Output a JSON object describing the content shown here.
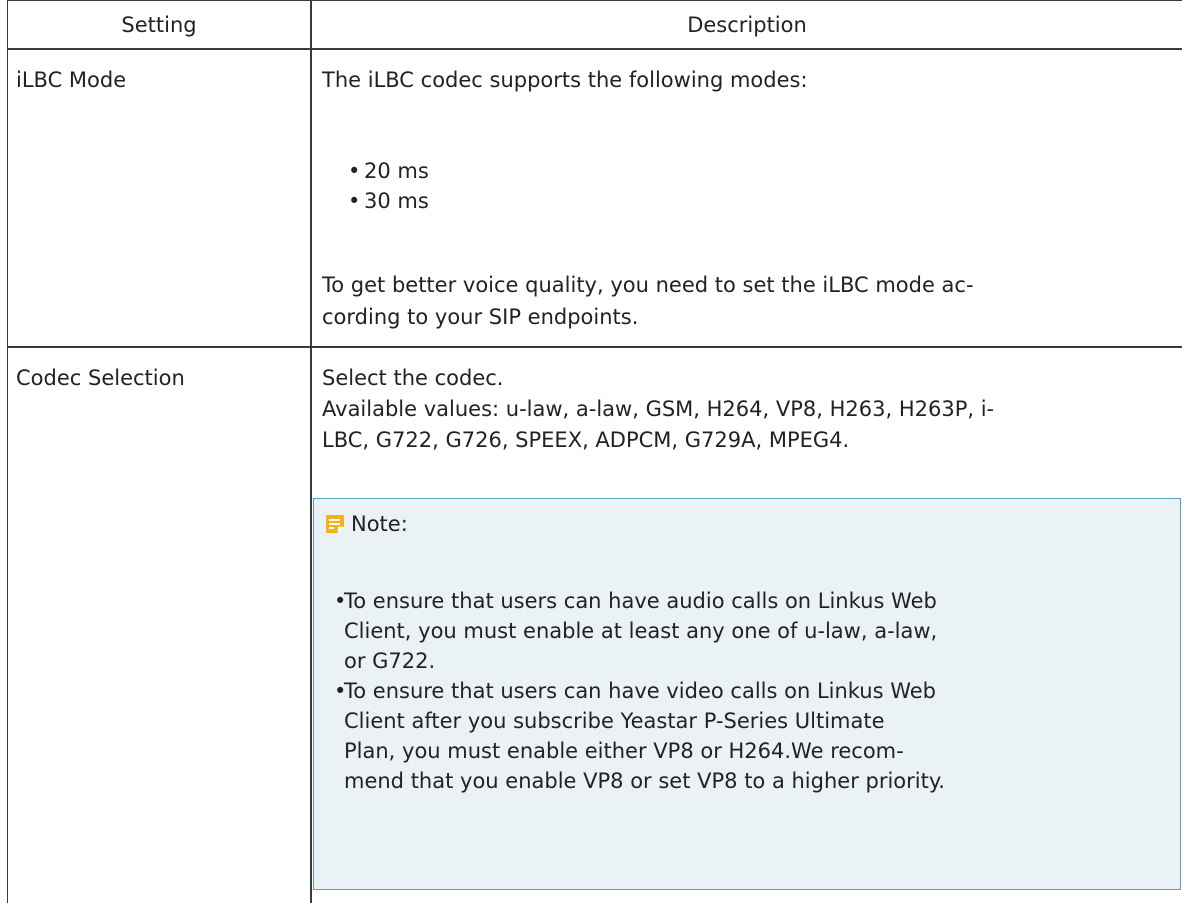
{
  "table": {
    "headers": {
      "setting": "Setting",
      "description": "Description"
    },
    "rows": [
      {
        "setting": "iLBC Mode",
        "intro": "The iLBC codec supports the following modes:",
        "modes": [
          "20 ms",
          "30 ms"
        ],
        "outro_lines": [
          "To get better voice quality, you need to set the iLBC mode ac-",
          "cording to your SIP endpoints."
        ]
      },
      {
        "setting": "Codec Selection",
        "lines": [
          "Select the codec.",
          "Available values: u-law, a-law, GSM, H264, VP8, H263, H263P, i-",
          "LBC, G722, G726, SPEEX, ADPCM, G729A, MPEG4."
        ],
        "note": {
          "icon": "note-icon",
          "title": "Note:",
          "items": [
            [
              "To ensure that users can have audio calls on Linkus Web",
              "Client, you must enable at least any one of u-law, a-law,",
              "or G722."
            ],
            [
              "To ensure that users can have video calls on Linkus Web",
              "Client after you subscribe Yeastar P-Series Ultimate",
              "Plan, you must enable either VP8 or H264.We recom-",
              "mend that you enable VP8 or set VP8 to a higher priority."
            ]
          ]
        }
      }
    ]
  },
  "colors": {
    "border": "#3a3a3a",
    "note_background": "#eaf2f5",
    "note_border": "#53a5c5",
    "note_icon": "#f2b21a"
  }
}
